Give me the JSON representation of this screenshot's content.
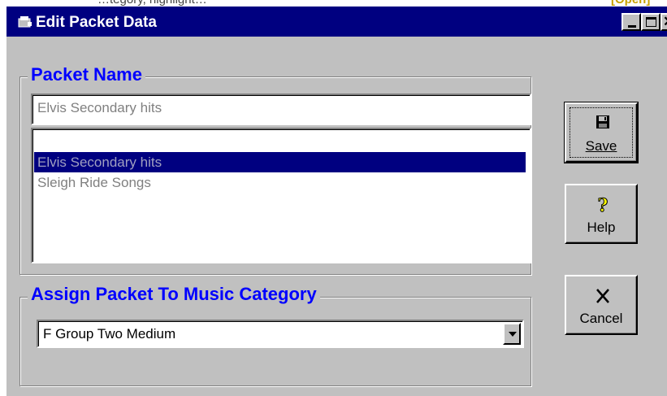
{
  "window": {
    "title": "Edit Packet Data",
    "title_bar_color": "#000080",
    "face_color": "#c0c0c0"
  },
  "background_text": {
    "partial_left": "…tegory, highlight…",
    "partial_right": "[Open]"
  },
  "caption_buttons": {
    "minimize_icon": "minimize-icon",
    "maximize_icon": "maximize-icon",
    "close_glyph": "✕"
  },
  "packet_name": {
    "legend": "Packet Name",
    "name_field_value": "Elvis Secondary hits",
    "list_items": [
      {
        "label": "",
        "selected": false
      },
      {
        "label": "Elvis Secondary hits",
        "selected": true
      },
      {
        "label": "Sleigh Ride Songs",
        "selected": false
      }
    ],
    "legend_color": "#0000ff"
  },
  "category": {
    "legend": "Assign Packet To Music Category",
    "selected_value": "F  Group Two Medium"
  },
  "buttons": {
    "save": {
      "label": "Save",
      "icon": "floppy-disk-icon"
    },
    "help": {
      "label": "Help",
      "icon": "question-mark-icon"
    },
    "cancel": {
      "label": "Cancel",
      "icon": "close-x-icon"
    }
  }
}
